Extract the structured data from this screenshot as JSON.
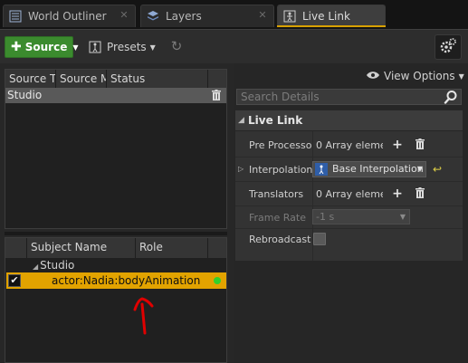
{
  "tabs": [
    {
      "label": "World Outliner",
      "icon": "world-outliner-icon",
      "active": false
    },
    {
      "label": "Layers",
      "icon": "layers-icon",
      "active": false
    },
    {
      "label": "Live Link",
      "icon": "live-link-icon",
      "active": true
    }
  ],
  "toolbar": {
    "source_label": "Source",
    "presets_label": "Presets"
  },
  "sources": {
    "columns": [
      "Source T",
      "Source M",
      "Status"
    ],
    "rows": [
      {
        "label": "Studio"
      }
    ]
  },
  "subjects": {
    "columns": [
      "Subject Name",
      "Role"
    ],
    "group": "Studio",
    "item": "actor:Nadia:bodyAnimation"
  },
  "details": {
    "view_options": "View Options",
    "search_placeholder": "Search Details",
    "category": "Live Link",
    "props": {
      "pre_processors": {
        "label": "Pre Processo",
        "value": "0 Array elemer"
      },
      "interpolation": {
        "label": "Interpolation",
        "value": "Base Interpolation"
      },
      "translators": {
        "label": "Translators",
        "value": "0 Array elemer"
      },
      "frame_rate": {
        "label": "Frame Rate",
        "value": "-1 s"
      },
      "rebroadcast": {
        "label": "Rebroadcast"
      }
    }
  },
  "colors": {
    "accent": "#e2a300",
    "source_button": "#3b8b2e",
    "status_dot": "#33d12a",
    "annotation": "#e00000"
  }
}
